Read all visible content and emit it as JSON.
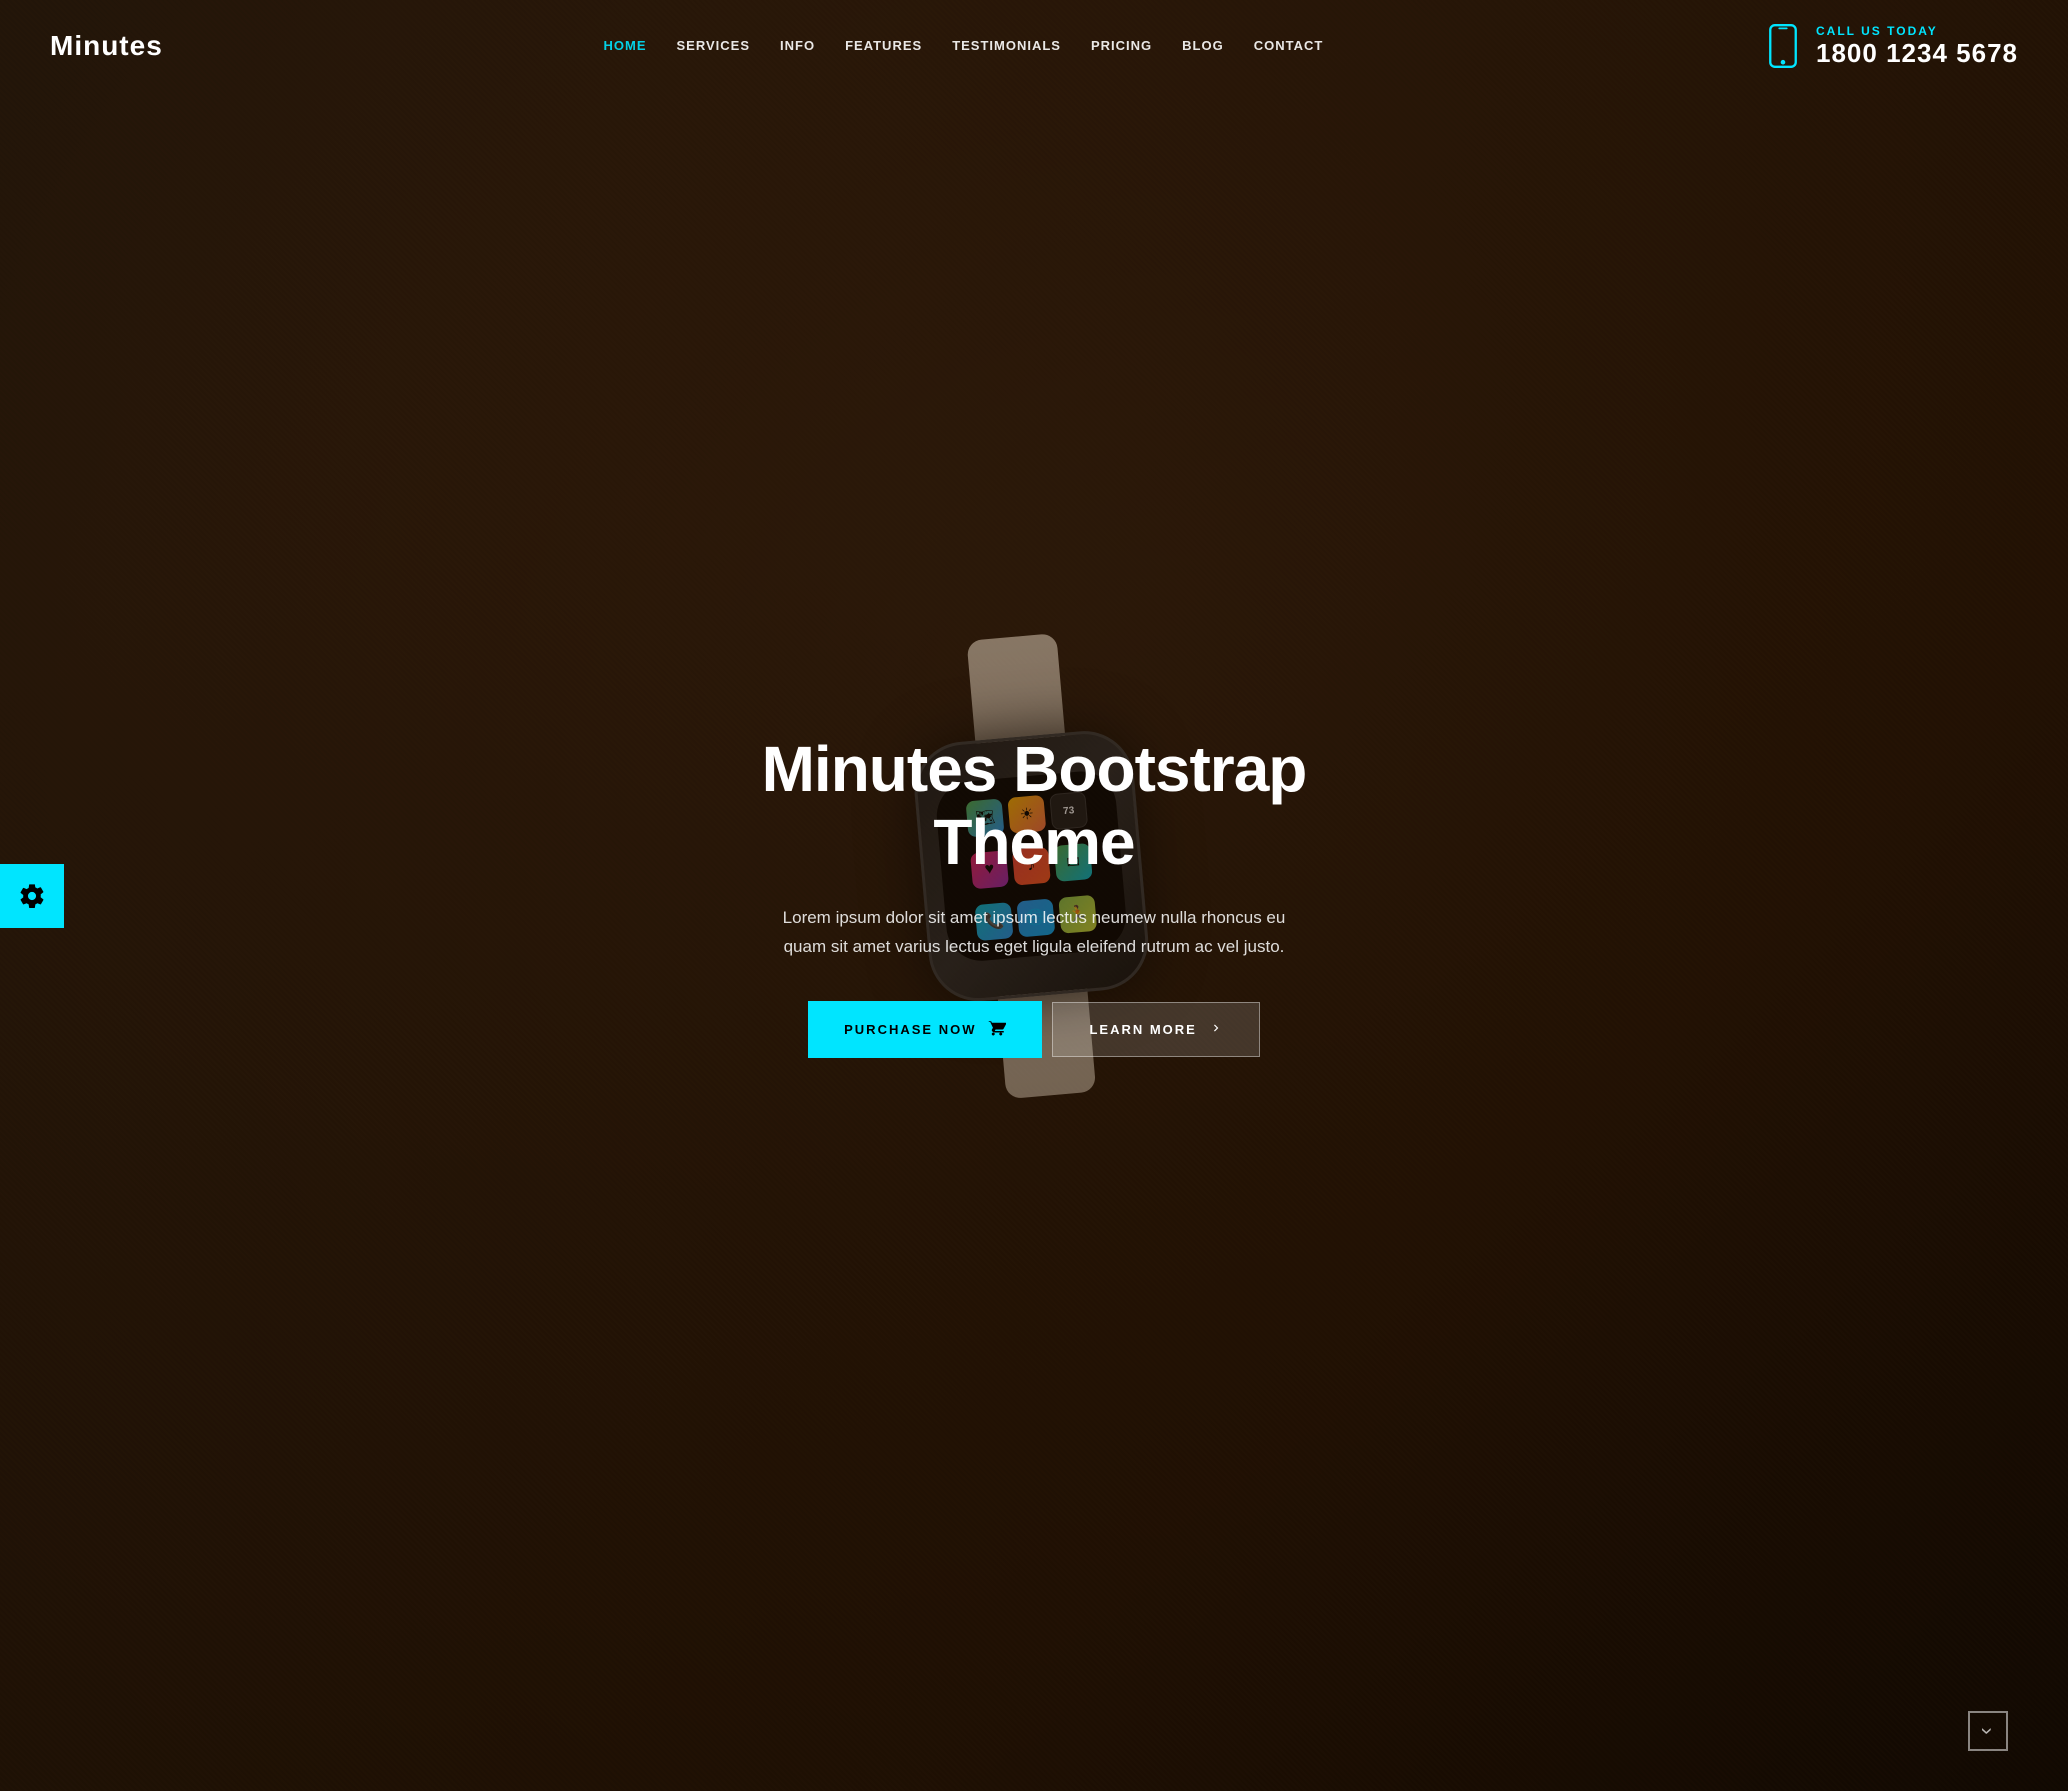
{
  "brand": {
    "name": "Minutes"
  },
  "header": {
    "nav": [
      {
        "label": "HOME",
        "active": true,
        "id": "home"
      },
      {
        "label": "SERVICES",
        "active": false,
        "id": "services"
      },
      {
        "label": "INFO",
        "active": false,
        "id": "info"
      },
      {
        "label": "FEATURES",
        "active": false,
        "id": "features"
      },
      {
        "label": "TESTIMONIALS",
        "active": false,
        "id": "testimonials"
      },
      {
        "label": "PRICING",
        "active": false,
        "id": "pricing"
      },
      {
        "label": "BLOG",
        "active": false,
        "id": "blog"
      },
      {
        "label": "CONTACT",
        "active": false,
        "id": "contact"
      }
    ],
    "call_label": "CALL US TODAY",
    "phone": "1800 1234 5678"
  },
  "hero": {
    "title": "Minutes Bootstrap Theme",
    "description": "Lorem ipsum dolor sit amet ipsum lectus neumew nulla rhoncus eu quam sit amet varius lectus eget ligula eleifend rutrum ac vel justo.",
    "btn_purchase": "PURCHASE NOW",
    "btn_learn": "LEARN MORE"
  },
  "settings": {
    "icon": "gear"
  },
  "colors": {
    "accent": "#00e5ff",
    "dark": "#1a0e08",
    "white": "#ffffff"
  },
  "watch": {
    "apps": [
      {
        "label": "🗺",
        "class": "app-maps"
      },
      {
        "label": "☀",
        "class": "app-weather"
      },
      {
        "label": "73",
        "class": "app-time"
      },
      {
        "label": "♥",
        "class": "app-activity"
      },
      {
        "label": "♪",
        "class": "app-music"
      },
      {
        "label": "✉",
        "class": "app-messages"
      },
      {
        "label": "📞",
        "class": "app-phone"
      },
      {
        "label": "🌐",
        "class": "app-globe"
      },
      {
        "label": "🏃",
        "class": "app-run"
      }
    ]
  }
}
